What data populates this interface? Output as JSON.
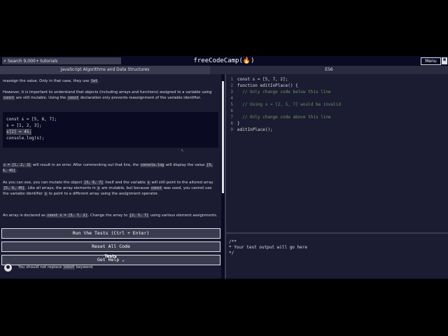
{
  "navbar": {
    "search_placeholder": "Search 9,000+ tutorials",
    "brand": "freeCodeCamp(🔥)",
    "menu_label": "Menu"
  },
  "breadcrumb": {
    "section": "JavaScript Algorithms and Data Structures",
    "subsection": "ES6"
  },
  "description": {
    "p1": "reassign the value. Only in that case, they use",
    "p1_code": "let",
    "p2a": "However, it is important to understand that objects (including arrays and functions) assigned to a variable using",
    "p2_code1": "const",
    "p2b": "are still mutable. Using the",
    "p2_code2": "const",
    "p2c": "declaration only prevents reassignment of the variable identifier.",
    "example_lines": [
      "const s = [5, 6, 7];",
      "s = [1, 2, 3];",
      "s[2] = 45;",
      "console.log(s);"
    ],
    "p3_code1": "s = [1, 2, 3]",
    "p3a": "will result in an error. After commenting out that line, the",
    "p3_code2": "console.log",
    "p3b": "will display the value",
    "p3_code3": "[5, 6, 45]",
    "p4a": "As you can see, you can mutate the object",
    "p4_code1": "[5, 6, 7]",
    "p4b": "itself and the variable",
    "p4_code2": "s",
    "p4c": "will still point to the altered array",
    "p4_code3": "[5, 6, 45]",
    "p4d": ". Like all arrays, the array elements in",
    "p4_code4": "s",
    "p4e": "are mutable, but because",
    "p4_code5": "const",
    "p4f": "was used, you cannot use the variable identifier",
    "p4_code6": "s",
    "p4g": "to point to a different array using the assignment operator.",
    "p5a": "An array is declared as",
    "p5_code1": "const s = [5, 7, 2]",
    "p5b": ". Change the array to",
    "p5_code2": "[2, 5, 7]",
    "p5c": "using various element assignments."
  },
  "buttons": {
    "run": "Run the Tests (Ctrl + Enter)",
    "reset": "Reset All Code",
    "help": "Get Help ⌄"
  },
  "tests": {
    "heading": "Tests",
    "items": [
      {
        "pre": "You should not replace",
        "code": "const",
        "post": "keyword."
      }
    ]
  },
  "editor": {
    "line_numbers": [
      "1",
      "2",
      "3",
      "4",
      "5",
      "6",
      "7",
      "8",
      "9"
    ],
    "lines": [
      "const s = [5, 7, 2];",
      "function editInPlace() {",
      "  // Only change code below this line",
      "",
      "  // Using s = [2, 5, 7] would be invalid",
      "",
      "  // Only change code above this line",
      "}",
      "editInPlace();"
    ]
  },
  "console": {
    "lines": [
      "/**",
      "* Your test output will go here",
      "*/"
    ]
  }
}
